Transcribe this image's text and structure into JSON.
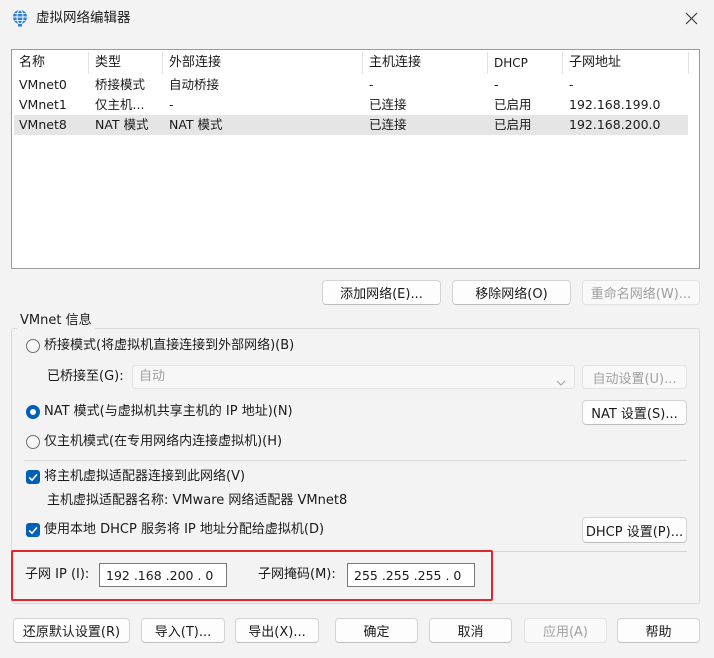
{
  "window": {
    "title": "虚拟网络编辑器",
    "title_icon": "globe-network-icon",
    "close_icon": "close-icon"
  },
  "table": {
    "columns": [
      "名称",
      "类型",
      "外部连接",
      "主机连接",
      "DHCP",
      "子网地址"
    ],
    "rows": [
      {
        "name": "VMnet0",
        "type": "桥接模式",
        "external": "自动桥接",
        "host": "-",
        "dhcp": "-",
        "subnet": "-"
      },
      {
        "name": "VMnet1",
        "type": "仅主机...",
        "external": "-",
        "host": "已连接",
        "dhcp": "已启用",
        "subnet": "192.168.199.0"
      },
      {
        "name": "VMnet8",
        "type": "NAT 模式",
        "external": "NAT 模式",
        "host": "已连接",
        "dhcp": "已启用",
        "subnet": "192.168.200.0"
      }
    ],
    "selected_network": "VMnet8",
    "buttons": {
      "add": "添加网络(E)...",
      "remove": "移除网络(O)",
      "rename": "重命名网络(W)..."
    }
  },
  "vmnet_info": {
    "group_label": "VMnet 信息",
    "selected_mode": "nat",
    "bridged": {
      "label": "桥接模式(将虚拟机直接连接到外部网络)(B)",
      "bridged_to_label": "已桥接至(G):",
      "bridged_to_value": "自动",
      "auto_settings_button": "自动设置(U)..."
    },
    "nat": {
      "label": "NAT 模式(与虚拟机共享主机的 IP 地址)(N)",
      "settings_button": "NAT 设置(S)..."
    },
    "host_only": {
      "label": "仅主机模式(在专用网络内连接虚拟机)(H)"
    },
    "connect_adapter": {
      "label": "将主机虚拟适配器连接到此网络(V)",
      "checked": true
    },
    "adapter_name": "主机虚拟适配器名称: VMware 网络适配器 VMnet8",
    "dhcp": {
      "label": "使用本地 DHCP 服务将 IP 地址分配给虚拟机(D)",
      "checked": true,
      "settings_button": "DHCP 设置(P)..."
    },
    "subnet_ip": {
      "label": "子网 IP (I):",
      "value": "192 .168 .200 . 0"
    },
    "subnet_mask": {
      "label": "子网掩码(M):",
      "value": "255 .255 .255 . 0"
    }
  },
  "footer": {
    "restore_defaults": "还原默认设置(R)",
    "import": "导入(T)...",
    "export": "导出(X)...",
    "ok": "确定",
    "cancel": "取消",
    "apply": "应用(A)",
    "help": "帮助"
  },
  "icons": {
    "dropdown": "chevron-down-icon",
    "checkbox_mark": "checkmark-icon"
  },
  "colors": {
    "accent": "#005fb8",
    "highlight_box": "#e0252d",
    "selected_row": "#e5e5e5",
    "disabled_text": "#a0a0a0",
    "window_background": "#f3f3f3"
  }
}
